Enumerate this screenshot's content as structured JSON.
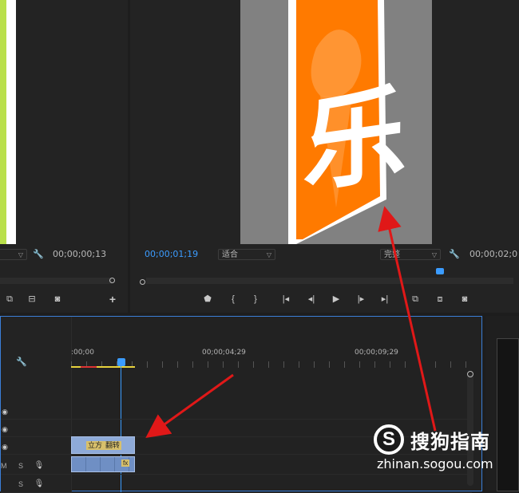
{
  "source_monitor": {
    "timecode": "00;00;00;13"
  },
  "program_monitor": {
    "current_time": "00;00;01;19",
    "fit_dropdown": "适合",
    "quality_dropdown": "完整",
    "duration": "00;00;02;0",
    "frame_char": "乐"
  },
  "timeline": {
    "ruler_labels": [
      ":00;00",
      "00;00;04;29",
      "00;00;09;29"
    ],
    "track_letters": [
      "M",
      "S",
      "S"
    ],
    "clip_labels": [
      "立方",
      "翻转"
    ],
    "fx_badge": "fx"
  },
  "watermark": {
    "brand": "搜狗指南",
    "url": "zhinan.sogou.com",
    "logo_letter": "S"
  },
  "colors": {
    "accent_blue": "#3b9cff",
    "orange": "#ff7a00",
    "arrow_red": "#e01818",
    "panel_bg": "#232323"
  }
}
